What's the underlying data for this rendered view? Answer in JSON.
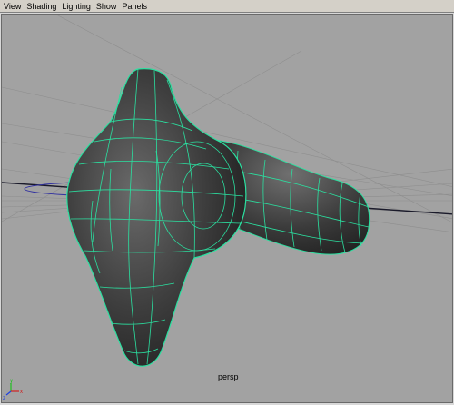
{
  "menubar": {
    "items": [
      {
        "label": "View"
      },
      {
        "label": "Shading"
      },
      {
        "label": "Lighting"
      },
      {
        "label": "Show"
      },
      {
        "label": "Panels"
      }
    ]
  },
  "viewport": {
    "camera_label": "persp",
    "background_color": "#a2a2a2",
    "mesh_color": "#2e2e2e",
    "wireframe_color": "#2be0a0",
    "grid_color": "#8a8a8a",
    "axis_gizmo": {
      "x_label": "x",
      "y_label": "y",
      "z_label": "z",
      "x_color": "#d02020",
      "y_color": "#20c020",
      "z_color": "#2040e0"
    }
  }
}
